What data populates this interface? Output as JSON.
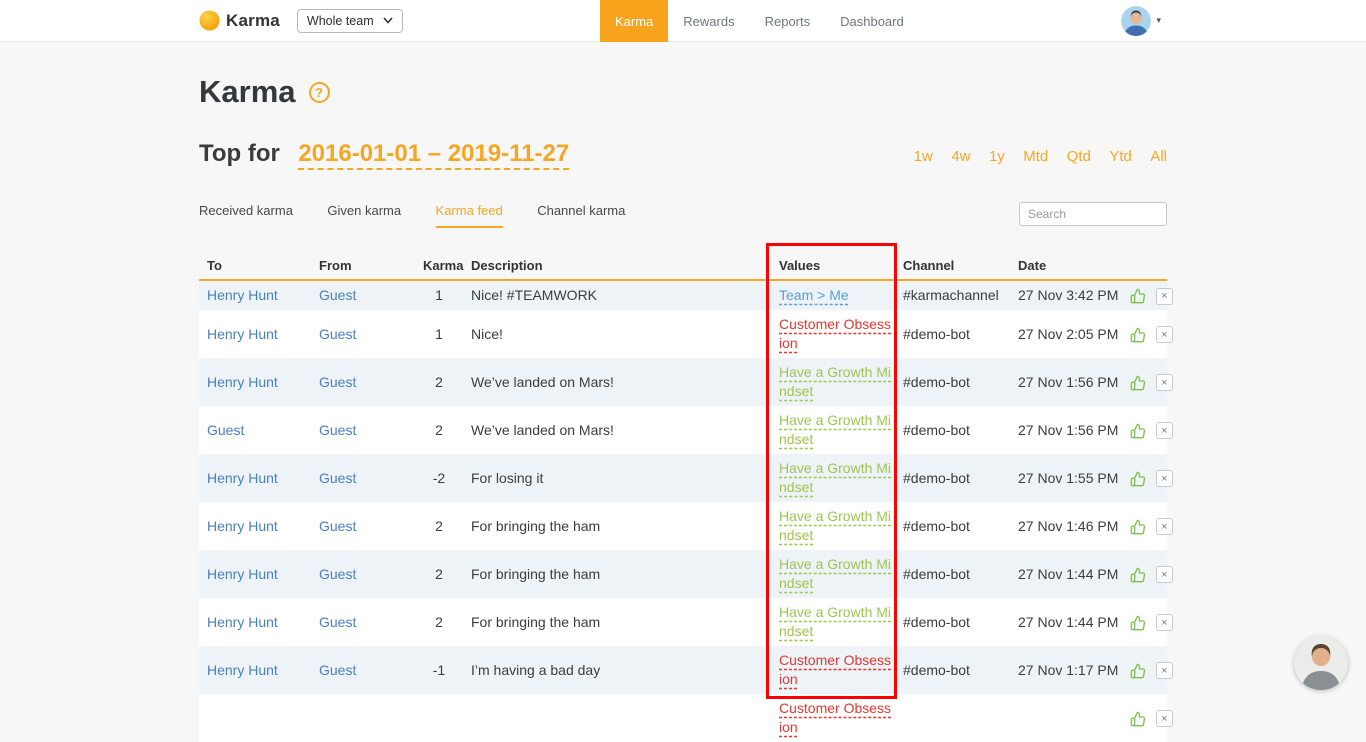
{
  "colors": {
    "accent_orange": "#f5a623",
    "nav_active_bg": "#f7a41c",
    "link_blue": "#4a81ba",
    "value_blue": "#55a1d6",
    "value_red": "#e0392e",
    "value_green": "#9cc653",
    "highlight_red": "#ff0000"
  },
  "icons": {
    "caret_down": "▾",
    "help": "?",
    "delete": "×"
  },
  "navbar": {
    "logo_text": "Karma",
    "team_selector_value": "Whole team",
    "items": [
      {
        "label": "Karma",
        "active": true
      },
      {
        "label": "Rewards",
        "active": false
      },
      {
        "label": "Reports",
        "active": false
      },
      {
        "label": "Dashboard",
        "active": false
      }
    ]
  },
  "page": {
    "title": "Karma",
    "top_for_label": "Top for",
    "date_range": "2016-01-01 – 2019-11-27",
    "range_links": [
      "1w",
      "4w",
      "1y",
      "Mtd",
      "Qtd",
      "Ytd",
      "All"
    ]
  },
  "tabs": [
    {
      "label": "Received karma",
      "active": false
    },
    {
      "label": "Given karma",
      "active": false
    },
    {
      "label": "Karma feed",
      "active": true
    },
    {
      "label": "Channel karma",
      "active": false
    }
  ],
  "search": {
    "placeholder": "Search"
  },
  "table": {
    "headers": [
      "To",
      "From",
      "Karma",
      "Description",
      "Values",
      "Channel",
      "Date"
    ],
    "rows": [
      {
        "to": "Henry Hunt",
        "from": "Guest",
        "karma": "1",
        "description": "Nice! #TEAMWORK",
        "value": "Team > Me",
        "value_color": "blue",
        "channel": "#karmachannel",
        "date": "27 Nov 3:42 PM"
      },
      {
        "to": "Henry Hunt",
        "from": "Guest",
        "karma": "1",
        "description": "Nice!",
        "value": "Customer Obsession",
        "value_color": "red",
        "channel": "#demo-bot",
        "date": "27 Nov 2:05 PM"
      },
      {
        "to": "Henry Hunt",
        "from": "Guest",
        "karma": "2",
        "description": "We’ve landed on Mars!",
        "value": "Have a Growth Mindset",
        "value_color": "green",
        "channel": "#demo-bot",
        "date": "27 Nov 1:56 PM"
      },
      {
        "to": "Guest",
        "from": "Guest",
        "karma": "2",
        "description": "We’ve landed on Mars!",
        "value": "Have a Growth Mindset",
        "value_color": "green",
        "channel": "#demo-bot",
        "date": "27 Nov 1:56 PM"
      },
      {
        "to": "Henry Hunt",
        "from": "Guest",
        "karma": "-2",
        "description": "For losing it",
        "value": "Have a Growth Mindset",
        "value_color": "green",
        "channel": "#demo-bot",
        "date": "27 Nov 1:55 PM"
      },
      {
        "to": "Henry Hunt",
        "from": "Guest",
        "karma": "2",
        "description": "For bringing the ham",
        "value": "Have a Growth Mindset",
        "value_color": "green",
        "channel": "#demo-bot",
        "date": "27 Nov 1:46 PM"
      },
      {
        "to": "Henry Hunt",
        "from": "Guest",
        "karma": "2",
        "description": "For bringing the ham",
        "value": "Have a Growth Mindset",
        "value_color": "green",
        "channel": "#demo-bot",
        "date": "27 Nov 1:44 PM"
      },
      {
        "to": "Henry Hunt",
        "from": "Guest",
        "karma": "2",
        "description": "For bringing the ham",
        "value": "Have a Growth Mindset",
        "value_color": "green",
        "channel": "#demo-bot",
        "date": "27 Nov 1:44 PM"
      },
      {
        "to": "Henry Hunt",
        "from": "Guest",
        "karma": "-1",
        "description": "I’m having a bad day",
        "value": "Customer Obsession",
        "value_color": "red",
        "channel": "#demo-bot",
        "date": "27 Nov 1:17 PM"
      },
      {
        "to": "",
        "from": "",
        "karma": "",
        "description": "",
        "value": "Customer Obsession",
        "value_color": "red",
        "channel": "",
        "date": ""
      }
    ]
  }
}
